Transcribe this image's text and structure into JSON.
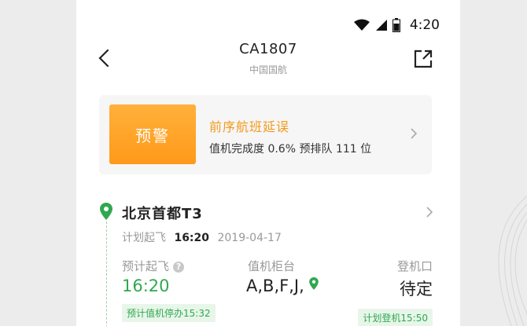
{
  "status_bar": {
    "time": "4:20"
  },
  "header": {
    "flight_no": "CA1807",
    "airline": "中国国航"
  },
  "alert": {
    "button_label": "预警",
    "title": "前序航班延误",
    "checkin_label": "值机完成度",
    "checkin_value": "0.6%",
    "queue_label": "预排队",
    "queue_value": "111",
    "queue_unit": "位"
  },
  "departure": {
    "airport": "北京首都T3",
    "planned_label": "计划起飞",
    "planned_time": "16:20",
    "planned_date": "2019-04-17",
    "est_label": "预计起飞",
    "est_time": "16:20",
    "counter_label": "值机柜台",
    "counter_value": "A,B,F,J,",
    "gate_label": "登机口",
    "gate_value": "待定",
    "checkin_close_tag": "预计值机停办15:32",
    "boarding_tag": "计划登机15:50"
  },
  "colors": {
    "accent_orange": "#ff9a1a",
    "accent_green": "#2fa84f"
  }
}
